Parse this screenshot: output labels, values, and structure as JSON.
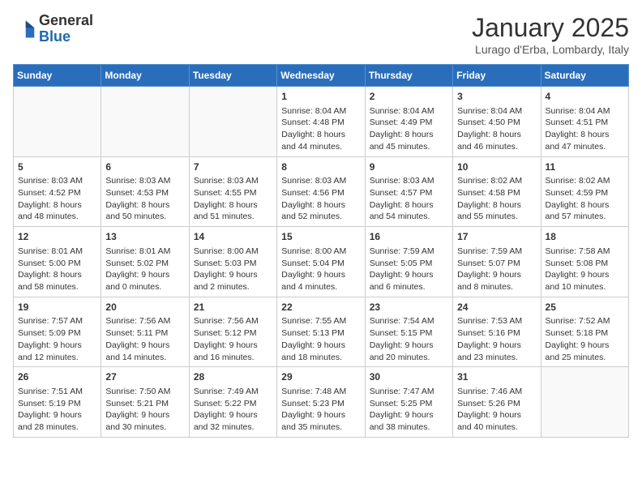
{
  "logo": {
    "general": "General",
    "blue": "Blue"
  },
  "header": {
    "title": "January 2025",
    "subtitle": "Lurago d'Erba, Lombardy, Italy"
  },
  "weekdays": [
    "Sunday",
    "Monday",
    "Tuesday",
    "Wednesday",
    "Thursday",
    "Friday",
    "Saturday"
  ],
  "weeks": [
    [
      {
        "day": "",
        "info": ""
      },
      {
        "day": "",
        "info": ""
      },
      {
        "day": "",
        "info": ""
      },
      {
        "day": "1",
        "info": "Sunrise: 8:04 AM\nSunset: 4:48 PM\nDaylight: 8 hours and 44 minutes."
      },
      {
        "day": "2",
        "info": "Sunrise: 8:04 AM\nSunset: 4:49 PM\nDaylight: 8 hours and 45 minutes."
      },
      {
        "day": "3",
        "info": "Sunrise: 8:04 AM\nSunset: 4:50 PM\nDaylight: 8 hours and 46 minutes."
      },
      {
        "day": "4",
        "info": "Sunrise: 8:04 AM\nSunset: 4:51 PM\nDaylight: 8 hours and 47 minutes."
      }
    ],
    [
      {
        "day": "5",
        "info": "Sunrise: 8:03 AM\nSunset: 4:52 PM\nDaylight: 8 hours and 48 minutes."
      },
      {
        "day": "6",
        "info": "Sunrise: 8:03 AM\nSunset: 4:53 PM\nDaylight: 8 hours and 50 minutes."
      },
      {
        "day": "7",
        "info": "Sunrise: 8:03 AM\nSunset: 4:55 PM\nDaylight: 8 hours and 51 minutes."
      },
      {
        "day": "8",
        "info": "Sunrise: 8:03 AM\nSunset: 4:56 PM\nDaylight: 8 hours and 52 minutes."
      },
      {
        "day": "9",
        "info": "Sunrise: 8:03 AM\nSunset: 4:57 PM\nDaylight: 8 hours and 54 minutes."
      },
      {
        "day": "10",
        "info": "Sunrise: 8:02 AM\nSunset: 4:58 PM\nDaylight: 8 hours and 55 minutes."
      },
      {
        "day": "11",
        "info": "Sunrise: 8:02 AM\nSunset: 4:59 PM\nDaylight: 8 hours and 57 minutes."
      }
    ],
    [
      {
        "day": "12",
        "info": "Sunrise: 8:01 AM\nSunset: 5:00 PM\nDaylight: 8 hours and 58 minutes."
      },
      {
        "day": "13",
        "info": "Sunrise: 8:01 AM\nSunset: 5:02 PM\nDaylight: 9 hours and 0 minutes."
      },
      {
        "day": "14",
        "info": "Sunrise: 8:00 AM\nSunset: 5:03 PM\nDaylight: 9 hours and 2 minutes."
      },
      {
        "day": "15",
        "info": "Sunrise: 8:00 AM\nSunset: 5:04 PM\nDaylight: 9 hours and 4 minutes."
      },
      {
        "day": "16",
        "info": "Sunrise: 7:59 AM\nSunset: 5:05 PM\nDaylight: 9 hours and 6 minutes."
      },
      {
        "day": "17",
        "info": "Sunrise: 7:59 AM\nSunset: 5:07 PM\nDaylight: 9 hours and 8 minutes."
      },
      {
        "day": "18",
        "info": "Sunrise: 7:58 AM\nSunset: 5:08 PM\nDaylight: 9 hours and 10 minutes."
      }
    ],
    [
      {
        "day": "19",
        "info": "Sunrise: 7:57 AM\nSunset: 5:09 PM\nDaylight: 9 hours and 12 minutes."
      },
      {
        "day": "20",
        "info": "Sunrise: 7:56 AM\nSunset: 5:11 PM\nDaylight: 9 hours and 14 minutes."
      },
      {
        "day": "21",
        "info": "Sunrise: 7:56 AM\nSunset: 5:12 PM\nDaylight: 9 hours and 16 minutes."
      },
      {
        "day": "22",
        "info": "Sunrise: 7:55 AM\nSunset: 5:13 PM\nDaylight: 9 hours and 18 minutes."
      },
      {
        "day": "23",
        "info": "Sunrise: 7:54 AM\nSunset: 5:15 PM\nDaylight: 9 hours and 20 minutes."
      },
      {
        "day": "24",
        "info": "Sunrise: 7:53 AM\nSunset: 5:16 PM\nDaylight: 9 hours and 23 minutes."
      },
      {
        "day": "25",
        "info": "Sunrise: 7:52 AM\nSunset: 5:18 PM\nDaylight: 9 hours and 25 minutes."
      }
    ],
    [
      {
        "day": "26",
        "info": "Sunrise: 7:51 AM\nSunset: 5:19 PM\nDaylight: 9 hours and 28 minutes."
      },
      {
        "day": "27",
        "info": "Sunrise: 7:50 AM\nSunset: 5:21 PM\nDaylight: 9 hours and 30 minutes."
      },
      {
        "day": "28",
        "info": "Sunrise: 7:49 AM\nSunset: 5:22 PM\nDaylight: 9 hours and 32 minutes."
      },
      {
        "day": "29",
        "info": "Sunrise: 7:48 AM\nSunset: 5:23 PM\nDaylight: 9 hours and 35 minutes."
      },
      {
        "day": "30",
        "info": "Sunrise: 7:47 AM\nSunset: 5:25 PM\nDaylight: 9 hours and 38 minutes."
      },
      {
        "day": "31",
        "info": "Sunrise: 7:46 AM\nSunset: 5:26 PM\nDaylight: 9 hours and 40 minutes."
      },
      {
        "day": "",
        "info": ""
      }
    ]
  ]
}
